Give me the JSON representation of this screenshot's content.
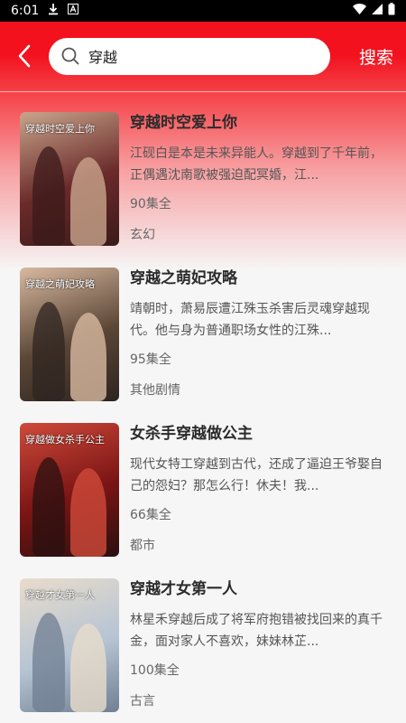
{
  "status_bar": {
    "time": "6:01"
  },
  "header": {
    "search_value": "穿越",
    "search_button": "搜索"
  },
  "results": [
    {
      "title": "穿越时空爱上你",
      "description": "江砚白是本是未来异能人。穿越到了千年前，正偶遇沈南歌被强迫配冥婚，江...",
      "episodes": "90集全",
      "genre": "玄幻",
      "cover_text": "穿越时空爱上你",
      "cover_colors": [
        "#6a2a2a",
        "#c9a58c",
        "#3b1a1a"
      ]
    },
    {
      "title": "穿越之萌妃攻略",
      "description": "靖朝时，萧易辰遭江殊玉杀害后灵魂穿越现代。他与身为普通职场女性的江殊...",
      "episodes": "95集全",
      "genre": "其他剧情",
      "cover_text": "穿越之萌妃攻略",
      "cover_colors": [
        "#5b4636",
        "#d8b9a0",
        "#2d2420"
      ]
    },
    {
      "title": "女杀手穿越做公主",
      "description": "现代女特工穿越到古代，还成了逼迫王爷娶自己的怨妇？那怎么行！休夫！我...",
      "episodes": "66集全",
      "genre": "都市",
      "cover_text": "穿越做女杀手公主",
      "cover_colors": [
        "#7a1414",
        "#d04a3a",
        "#2a1010"
      ]
    },
    {
      "title": "穿越才女第一人",
      "description": "林星禾穿越后成了将军府抱错被找回来的真千金，面对家人不喜欢，妹妹林芷...",
      "episodes": "100集全",
      "genre": "古言",
      "cover_text": "穿越才女第一人",
      "cover_colors": [
        "#b6c4d4",
        "#e8dccb",
        "#6f7e92"
      ]
    }
  ]
}
